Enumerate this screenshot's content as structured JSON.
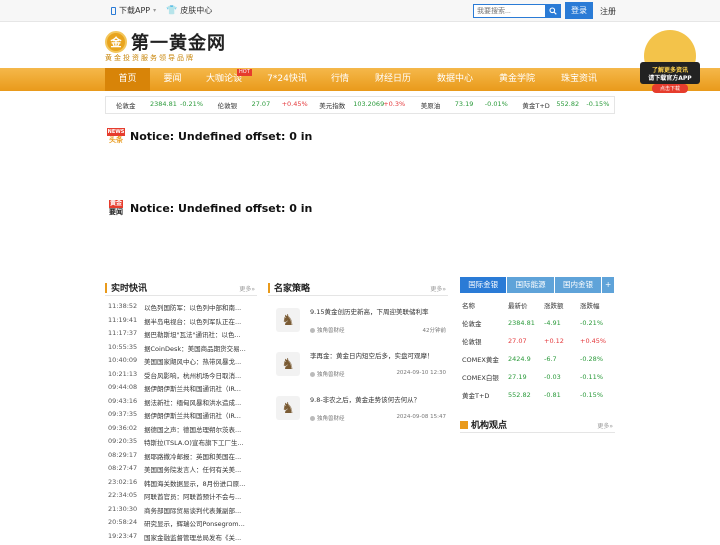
{
  "topbar": {
    "download": "下载APP",
    "skin": "皮肤中心",
    "search_placeholder": "我要搜索...",
    "login": "登录",
    "register": "注册"
  },
  "logo": {
    "coin": "金",
    "name": "第一黄金网",
    "slogan": "黄金投资服务领导品牌"
  },
  "nav": {
    "items": [
      "首页",
      "要闻",
      "大咖论谈",
      "7*24快讯",
      "行情",
      "财经日历",
      "数据中心",
      "黄金学院",
      "珠宝资讯"
    ],
    "hot": "HOT"
  },
  "promo": {
    "line1": "了解更多资讯",
    "line2": "请下载官方APP",
    "btn": "点击下载"
  },
  "ticker": [
    {
      "name": "伦敦金",
      "value": "2384.81",
      "change": "-0.21%",
      "dir": "down"
    },
    {
      "name": "伦敦银",
      "value": "27.07",
      "change": "+0.45%",
      "dir": "up"
    },
    {
      "name": "美元指数",
      "value": "103.2069",
      "change": "+0.3%",
      "dir": "up"
    },
    {
      "name": "美原油",
      "value": "73.19",
      "change": "-0.01%",
      "dir": "down"
    },
    {
      "name": "黄金T+D",
      "value": "552.82",
      "change": "-0.15%",
      "dir": "down"
    }
  ],
  "notices": [
    {
      "icon_top": "NEWS",
      "icon_bottom": "头条",
      "text": "Notice: Undefined offset: 0 in"
    },
    {
      "icon_top": "黄金",
      "icon_bottom": "要闻",
      "text": "Notice: Undefined offset: 0 in"
    }
  ],
  "flash": {
    "title": "实时快讯",
    "more": "更多»",
    "items": [
      {
        "time": "11:38:52",
        "text": "以色列国防军：以色列中部和南..."
      },
      {
        "time": "11:19:41",
        "text": "据半岛电视台：以色列军队正在..."
      },
      {
        "time": "11:17:37",
        "text": "据巴勒斯坦\"瓦法\"通讯社：以色..."
      },
      {
        "time": "10:55:35",
        "text": "据CoinDesk：美国商品期货交易..."
      },
      {
        "time": "10:40:09",
        "text": "美国国家飓风中心：热带风暴戈..."
      },
      {
        "time": "10:21:13",
        "text": "受台风影响，杭州机场今日取消..."
      },
      {
        "time": "09:44:08",
        "text": "据伊朗伊斯兰共和国通讯社（IR..."
      },
      {
        "time": "09:43:16",
        "text": "据法新社：缅甸风暴和洪水造成..."
      },
      {
        "time": "09:37:35",
        "text": "据伊朗伊斯兰共和国通讯社（IR..."
      },
      {
        "time": "09:36:02",
        "text": "据德国之声：德国总理朔尔茨表..."
      },
      {
        "time": "09:20:35",
        "text": "特斯拉(TSLA.O)宣布旗下工厂生..."
      },
      {
        "time": "08:29:17",
        "text": "据耶路撒冷邮报：英国和美国在..."
      },
      {
        "time": "08:27:47",
        "text": "美国国务院发言人：任何有关美..."
      },
      {
        "time": "23:02:16",
        "text": "韩国海关数据显示，8月份进口原..."
      },
      {
        "time": "22:34:05",
        "text": "阿联酋官员：阿联酋预计不会与..."
      },
      {
        "time": "21:30:30",
        "text": "商务部国际贸易谈判代表兼副部..."
      },
      {
        "time": "20:58:24",
        "text": "研究显示，辉瑞公司Ponsegrom..."
      },
      {
        "time": "19:23:47",
        "text": "国家金融监督管理总局发布《关..."
      }
    ]
  },
  "strategy": {
    "title": "名家策略",
    "more": "更多»",
    "items": [
      {
        "title": "9.15黄金创历史新高，下周迎美联储利率",
        "author": "独角兽财经",
        "time": "42分钟前"
      },
      {
        "title": "李再金：黄金日内短空后多，实盘可观摩！",
        "author": "独角兽财经",
        "time": "2024-09-10 12:30"
      },
      {
        "title": "9.8-非农之后，黄金走势该何去何从？",
        "author": "独角兽财经",
        "time": "2024-09-08 15:47"
      }
    ]
  },
  "market": {
    "tabs": [
      "国际金银",
      "国际能源",
      "国内金银",
      "+"
    ],
    "headers": [
      "名称",
      "最新价",
      "涨跌额",
      "涨跌幅"
    ],
    "rows": [
      {
        "name": "伦敦金",
        "price": "2384.81",
        "diff": "-4.91",
        "pct": "-0.21%",
        "dir": "down"
      },
      {
        "name": "伦敦银",
        "price": "27.07",
        "diff": "+0.12",
        "pct": "+0.45%",
        "dir": "up"
      },
      {
        "name": "COMEX黄金",
        "price": "2424.9",
        "diff": "-6.7",
        "pct": "-0.28%",
        "dir": "down"
      },
      {
        "name": "COMEX白银",
        "price": "27.19",
        "diff": "-0.03",
        "pct": "-0.11%",
        "dir": "down"
      },
      {
        "name": "黄金T+D",
        "price": "552.82",
        "diff": "-0.81",
        "pct": "-0.15%",
        "dir": "down"
      }
    ]
  },
  "institution": {
    "title": "机构观点",
    "more": "更多»"
  },
  "colors": {
    "nav": "#e99a1b",
    "blue": "#2a7bd6",
    "up": "#e4393c",
    "down": "#2a9a3a"
  }
}
